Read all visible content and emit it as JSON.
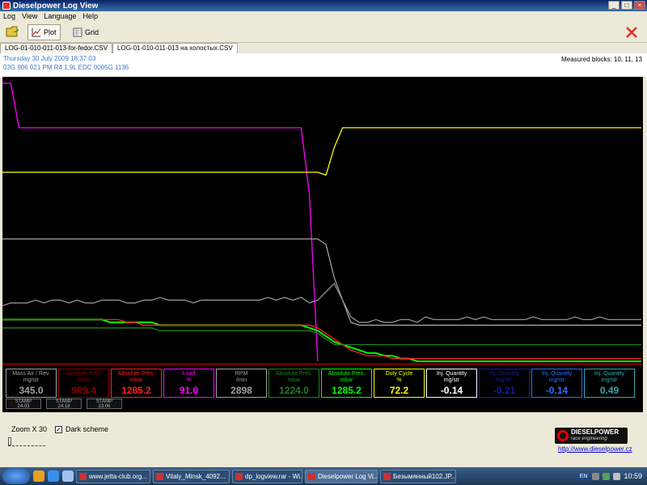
{
  "window": {
    "title": "Dieselpower Log View"
  },
  "menu": [
    "Log",
    "View",
    "Language",
    "Help"
  ],
  "toolbar": {
    "plot_label": "Plot",
    "grid_label": "Grid"
  },
  "tabs": [
    "LOG-01-010-011-013-for-fedor.CSV",
    "LOG-01-010-011-013 на холостых.CSV"
  ],
  "info": {
    "date": "Thursday 30 July 2009 18:37:03",
    "car": "03G 906 021 PM  R4 1,9L EDC  0005G  1136",
    "blocks": "Measured blocks: 10, 11, 13"
  },
  "colors": {
    "plot_bg": "#000000"
  },
  "plot_series": [
    {
      "color": "#ff00ff",
      "values": [
        100,
        100,
        84,
        84,
        84,
        84,
        84,
        84,
        84,
        84,
        84,
        84,
        84,
        84,
        84,
        84,
        84,
        84,
        84,
        84,
        84,
        84,
        84,
        84,
        84,
        84,
        84,
        84,
        84,
        84,
        84,
        84,
        84,
        84,
        84,
        84,
        84,
        60,
        0
      ]
    },
    {
      "color": "#ffff00",
      "values": [
        68,
        68,
        68,
        68,
        68,
        68,
        68,
        68,
        68,
        68,
        68,
        68,
        68,
        68,
        68,
        68,
        68,
        68,
        68,
        68,
        68,
        68,
        68,
        68,
        68,
        68,
        68,
        68,
        68,
        68,
        68,
        68,
        68,
        68,
        68,
        68,
        68,
        68,
        68,
        67,
        77,
        84,
        84,
        84,
        84,
        84,
        84,
        84,
        84,
        84,
        84,
        84,
        84,
        84,
        84,
        84,
        84,
        84,
        84,
        84,
        84,
        84,
        84,
        84,
        84,
        84,
        84,
        84,
        84,
        84,
        84,
        84,
        84,
        84,
        84,
        84,
        84,
        84
      ]
    },
    {
      "color": "#a0a0a0",
      "values": [
        44,
        44,
        44,
        44,
        44,
        44,
        44,
        44,
        44,
        44,
        44,
        44,
        44,
        44,
        44,
        44,
        44,
        44,
        44,
        44,
        44,
        44,
        44,
        44,
        44,
        44,
        44,
        44,
        44,
        44,
        44,
        44,
        44,
        44,
        44,
        44,
        44,
        44,
        44,
        42,
        30,
        22,
        14,
        13,
        13,
        13,
        13,
        13,
        13,
        13,
        13,
        13,
        13,
        13,
        13,
        13,
        13,
        13,
        13,
        13,
        13,
        13,
        13,
        13,
        13,
        13,
        13,
        13,
        13,
        13,
        13,
        13,
        13,
        13,
        13,
        13,
        13,
        13
      ]
    },
    {
      "color": "#909090",
      "values": [
        20,
        21,
        21,
        21,
        22,
        21,
        22,
        22,
        21,
        22,
        21,
        21,
        22,
        22,
        22,
        21,
        21,
        22,
        22,
        23,
        22,
        22,
        22,
        21,
        22,
        22,
        22,
        22,
        22,
        22,
        22,
        22,
        23,
        22,
        23,
        22,
        23,
        21,
        22,
        25,
        28,
        22,
        16,
        14,
        14,
        15,
        14,
        14,
        15,
        15,
        14,
        16,
        15,
        15,
        15,
        15,
        16,
        15,
        16,
        15,
        15,
        15,
        15,
        15,
        16,
        15,
        15,
        15,
        15,
        16,
        15,
        15,
        16,
        15,
        15,
        15,
        15,
        15
      ]
    },
    {
      "color": "#00ff00",
      "values": [
        15,
        15,
        15,
        15,
        15,
        15,
        15,
        15,
        15,
        15,
        15,
        15,
        15,
        14,
        14,
        14,
        14,
        14,
        14,
        13,
        13,
        13,
        13,
        13,
        13,
        13,
        13,
        13,
        13,
        13,
        13,
        13,
        13,
        13,
        13,
        13,
        13,
        12,
        11,
        9,
        7,
        6,
        5,
        4,
        3,
        3,
        2,
        2,
        1,
        1,
        0,
        0,
        0,
        0,
        0,
        0,
        0,
        0,
        0,
        0,
        0,
        0,
        0,
        0,
        0,
        0,
        0,
        0,
        0,
        0,
        0,
        0,
        0,
        0,
        0,
        0,
        0,
        0
      ]
    },
    {
      "color": "#ff2020",
      "values": [
        15,
        15,
        15,
        15,
        15,
        15,
        15,
        15,
        15,
        15,
        15,
        15,
        15,
        15,
        15,
        14,
        14,
        13,
        13,
        13,
        13,
        13,
        13,
        13,
        13,
        13,
        13,
        13,
        13,
        13,
        13,
        13,
        13,
        13,
        13,
        13,
        13,
        13,
        12,
        10,
        8,
        6,
        4,
        3,
        2,
        2,
        2,
        1,
        1,
        1,
        1,
        1,
        1,
        1,
        1,
        1,
        1,
        1,
        1,
        1,
        1,
        1,
        1,
        1,
        1,
        1,
        1,
        1,
        1,
        1,
        1,
        1,
        1,
        1,
        1,
        1,
        1,
        1
      ]
    },
    {
      "color": "#208020",
      "values": [
        12,
        12,
        12,
        12,
        12,
        12,
        12,
        12,
        12,
        12,
        12,
        12,
        12,
        12,
        12,
        12,
        12,
        12,
        12,
        11,
        11,
        11,
        11,
        11,
        11,
        11,
        11,
        11,
        11,
        11,
        11,
        11,
        11,
        11,
        11,
        11,
        11,
        11,
        10,
        8,
        6,
        6,
        6,
        6,
        6,
        6,
        6,
        6,
        6,
        6,
        6,
        6,
        6,
        6,
        6,
        6,
        6,
        6,
        6,
        6,
        6,
        6,
        6,
        6,
        6,
        6,
        6,
        6,
        6,
        6,
        6,
        6,
        6,
        6,
        6,
        6,
        6,
        6
      ]
    },
    {
      "color": "#c00000",
      "values": [
        -1,
        -1,
        -1,
        -1,
        -1,
        -1,
        -1,
        -1,
        -1,
        -1,
        -1,
        -1,
        -1,
        -1,
        -1,
        -1,
        -1,
        -1,
        -1,
        -1,
        -1,
        -1,
        -1,
        -1,
        -1,
        -1,
        -1,
        -1,
        -1,
        -1,
        -1,
        -1,
        -1,
        -1,
        -1,
        -1,
        -1,
        -1,
        -1,
        -1,
        -1,
        -1,
        -1,
        -1,
        -1,
        -1,
        -1,
        -1,
        -1,
        -1,
        -1,
        -1,
        -1,
        -1,
        -1,
        -1,
        -1,
        -1,
        -1,
        -1,
        -1,
        -1,
        -1,
        -1,
        -1,
        -1,
        -1,
        -1,
        -1,
        -1,
        -1,
        -1,
        -1,
        -1,
        -1,
        -1,
        -1,
        -1
      ]
    }
  ],
  "gauges": [
    {
      "label": "Mass Air / Rev.",
      "unit": "mg/str",
      "value": "345.0",
      "color": "#a0a0a0"
    },
    {
      "label": "Absolute Pres.",
      "unit": "mbar",
      "value": "989.4",
      "color": "#8b0000"
    },
    {
      "label": "Absolute Pres.",
      "unit": "mbar",
      "value": "1285.2",
      "color": "#ff2020"
    },
    {
      "label": "Load",
      "unit": "%",
      "value": "91.0",
      "color": "#ff00ff"
    },
    {
      "label": "RPM",
      "unit": "/min",
      "value": "2898",
      "color": "#a0a0a0"
    },
    {
      "label": "Absolute Pres.",
      "unit": "mbar",
      "value": "1224.0",
      "color": "#208020"
    },
    {
      "label": "Absolute Pres.",
      "unit": "mbar",
      "value": "1285.2",
      "color": "#00ff00"
    },
    {
      "label": "Duty Cycle",
      "unit": "%",
      "value": "72.2",
      "color": "#ffff00"
    },
    {
      "label": "Inj. Quantity",
      "unit": "mg/str",
      "value": "-0.14",
      "color": "#ffffff"
    },
    {
      "label": "Inj. Quantity",
      "unit": "mg/str",
      "value": "-0.21",
      "color": "#1a1aa0"
    },
    {
      "label": "Inj. Quantity",
      "unit": "mg/str",
      "value": "-0.14",
      "color": "#2e6cff"
    },
    {
      "label": "Inj. Quantity",
      "unit": "mg/str",
      "value": "0.49",
      "color": "#3aa8a8"
    }
  ],
  "stamps": [
    {
      "label": "STAMP",
      "value": "24.03"
    },
    {
      "label": "STAMP",
      "value": "24.18"
    },
    {
      "label": "STAMP",
      "value": "23.06"
    }
  ],
  "zoom": {
    "label": "Zoom",
    "value": "X 30"
  },
  "dark_scheme": {
    "label": "Dark scheme",
    "checked": true
  },
  "logo": {
    "name": "DIESELPOWER",
    "tagline": "race engineering"
  },
  "website": "http://www.dieselpower.cz",
  "taskbar": {
    "tasks": [
      {
        "label": "www.jetta-club.org...",
        "active": false
      },
      {
        "label": "Vitaly_Minsk_4092...",
        "active": false
      },
      {
        "label": "dp_logview.rar - Wi...",
        "active": false
      },
      {
        "label": "Dieselpower Log Vi...",
        "active": true
      },
      {
        "label": "Безымянный102.JP...",
        "active": false
      }
    ],
    "lang": "EN",
    "clock": "10:59"
  }
}
